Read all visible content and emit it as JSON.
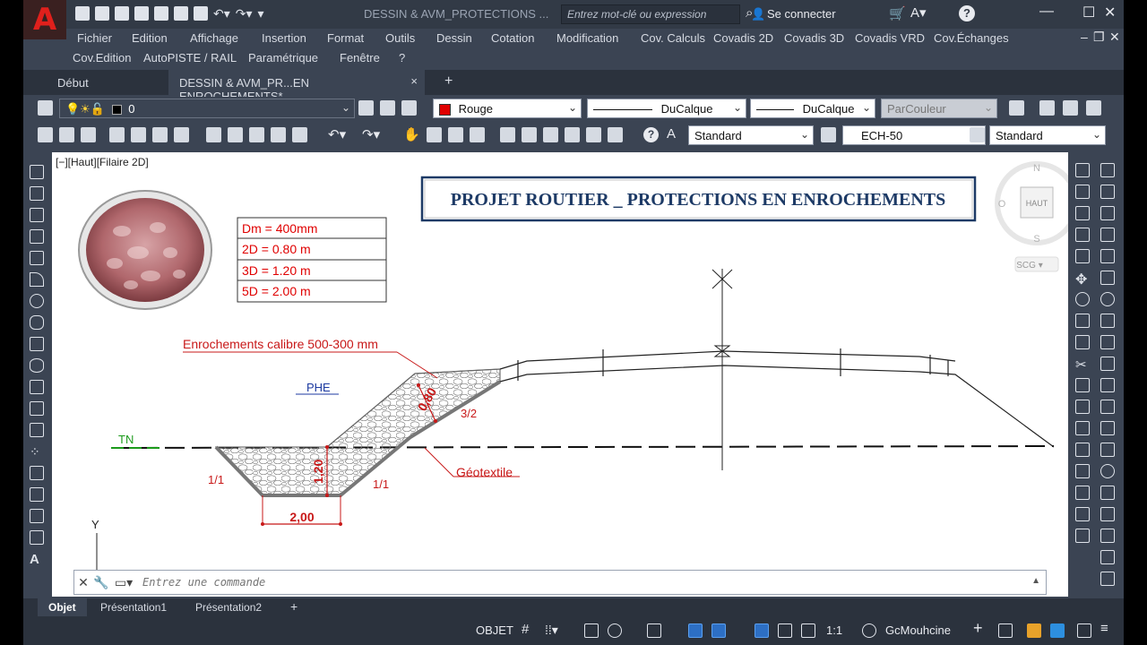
{
  "app": {
    "logo": "A",
    "doc_title": "DESSIN & AVM_PROTECTIONS ...",
    "search_placeholder": "Entrez mot-clé ou expression",
    "signin": "Se connecter",
    "help": "?"
  },
  "menu": {
    "row1": [
      "Fichier",
      "Edition",
      "Affichage",
      "Insertion",
      "Format",
      "Outils",
      "Dessin",
      "Cotation",
      "Modification",
      "Cov. Calculs",
      "Covadis 2D",
      "Covadis 3D",
      "Covadis VRD",
      "Cov.Échanges"
    ],
    "row2": [
      "Cov.Edition",
      "AutoPISTE / RAIL",
      "Paramétrique",
      "Fenêtre",
      "?"
    ]
  },
  "tabs": {
    "start": "Début",
    "drawing": "DESSIN & AVM_PR...EN ENROCHEMENTS*",
    "close": "×",
    "add": "+"
  },
  "properties": {
    "layer": "0",
    "color": "Rouge",
    "linetype": "DuCalque",
    "lineweight": "DuCalque",
    "plotstyle": "ParCouleur",
    "color_swatch": "#e00000"
  },
  "styles": {
    "text_style": "Standard",
    "dim_style": "ECH-50",
    "table_style": "Standard"
  },
  "viewport": {
    "label": "[−][Haut][Filaire 2D]"
  },
  "viewcube": {
    "north": "N",
    "south": "S",
    "east": "E",
    "west": "O",
    "face": "HAUT",
    "ucs": "SCG"
  },
  "drawing": {
    "title": "PROJET ROUTIER _ PROTECTIONS EN ENROCHEMENTS",
    "table_rows": [
      "Dm = 400mm",
      "2D = 0.80 m",
      "3D = 1.20 m",
      "5D = 2.00 m"
    ],
    "label_rock": "Enrochements calibre 500-300 mm",
    "label_phe": "PHE",
    "label_tn": "TN",
    "label_geotextile": "Géotextile",
    "slope_left": "1/1",
    "slope_right": "1/1",
    "slope_bank": "3/2",
    "dim_thickness": "0,80",
    "dim_depth": "1,20",
    "dim_width": "2,00",
    "axis_y": "Y"
  },
  "command": {
    "placeholder": "Entrez une commande"
  },
  "layout_tabs": [
    "Objet",
    "Présentation1",
    "Présentation2"
  ],
  "status": {
    "model": "OBJET",
    "scale": "1:1",
    "workspace": "GcMouhcine"
  }
}
